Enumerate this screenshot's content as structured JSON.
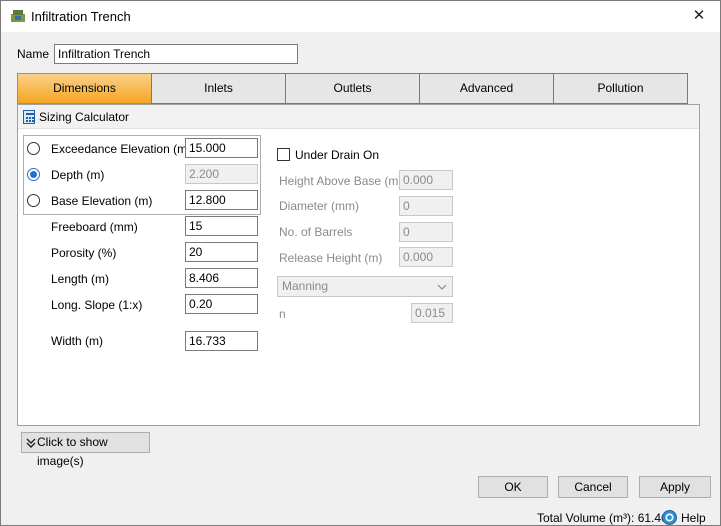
{
  "window": {
    "title": "Infiltration Trench",
    "close_glyph": "✕",
    "icon": "trench-app-icon"
  },
  "name_field": {
    "label": "Name",
    "value": "Infiltration Trench"
  },
  "tabs": [
    {
      "label": "Dimensions",
      "active": true
    },
    {
      "label": "Inlets",
      "active": false
    },
    {
      "label": "Outlets",
      "active": false
    },
    {
      "label": "Advanced",
      "active": false
    },
    {
      "label": "Pollution",
      "active": false
    }
  ],
  "sizing": {
    "label": "Sizing Calculator",
    "icon": "calculator-icon"
  },
  "radios": {
    "exceedance": {
      "label": "Exceedance Elevation (m)",
      "value": "15.000",
      "checked": false
    },
    "depth": {
      "label": "Depth (m)",
      "value": "2.200",
      "checked": true
    },
    "base": {
      "label": "Base Elevation (m)",
      "value": "12.800",
      "checked": false
    }
  },
  "fields": {
    "freeboard": {
      "label": "Freeboard (mm)",
      "value": "15"
    },
    "porosity": {
      "label": "Porosity (%)",
      "value": "20"
    },
    "length": {
      "label": "Length (m)",
      "value": "8.406"
    },
    "slope": {
      "label": "Long. Slope (1:x)",
      "value": "0.20"
    },
    "width": {
      "label": "Width (m)",
      "value": "16.733"
    }
  },
  "under_drain": {
    "label": "Under Drain On",
    "checked": false,
    "height_above_base": {
      "label": "Height Above Base (m)",
      "value": "0.000"
    },
    "diameter": {
      "label": "Diameter (mm)",
      "value": "0"
    },
    "barrels": {
      "label": "No. of Barrels",
      "value": "0"
    },
    "release_height": {
      "label": "Release Height (m)",
      "value": "0.000"
    },
    "roughness_method": "Manning",
    "n": {
      "label": "n",
      "value": "0.015"
    }
  },
  "show_images": {
    "label": "Click to show image(s)",
    "icon": "double-chevron-down-icon"
  },
  "buttons": {
    "ok": "OK",
    "cancel": "Cancel",
    "apply": "Apply"
  },
  "status": {
    "total_volume": "Total Volume (m³): 61.467",
    "help": "Help"
  },
  "colors": {
    "active_tab": "#f5a623",
    "radio_accent": "#1e73d2",
    "help_icon": "#2d8fd6"
  }
}
